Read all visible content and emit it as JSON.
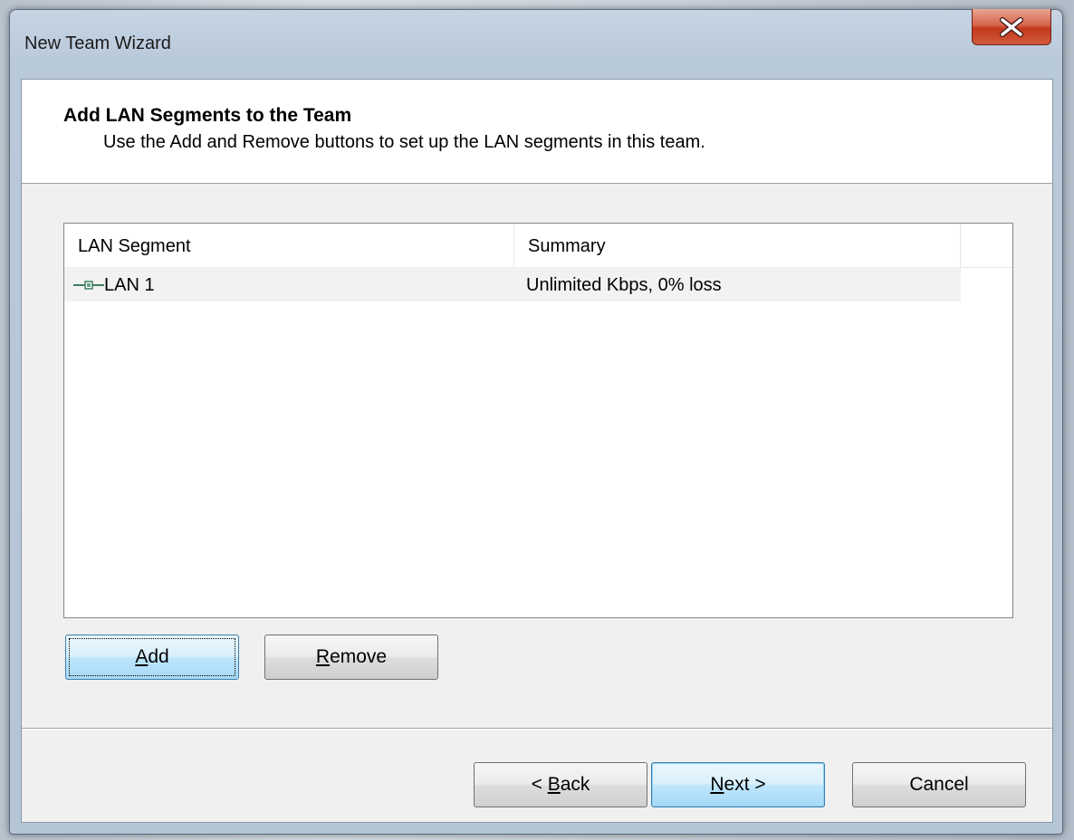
{
  "window": {
    "title": "New Team Wizard",
    "close_icon": "close-icon"
  },
  "header": {
    "title": "Add LAN Segments to the Team",
    "subtitle": "Use the Add and Remove buttons to set up the LAN segments in this team."
  },
  "list": {
    "columns": [
      "LAN Segment",
      "Summary"
    ],
    "rows": [
      {
        "segment": "LAN 1",
        "summary": "Unlimited Kbps, 0% loss",
        "icon": "network-cable-icon"
      }
    ]
  },
  "buttons": {
    "add": {
      "mnemonic": "A",
      "rest": "dd"
    },
    "remove": {
      "mnemonic": "R",
      "rest": "emove"
    },
    "back": {
      "prefix": "< ",
      "mnemonic": "B",
      "rest": "ack"
    },
    "next": {
      "mnemonic": "N",
      "rest": "ext >"
    },
    "cancel": "Cancel"
  },
  "colors": {
    "close_button": "#c2391c",
    "default_button": "#bee6fd",
    "row_selected": "#f2f2f2"
  }
}
